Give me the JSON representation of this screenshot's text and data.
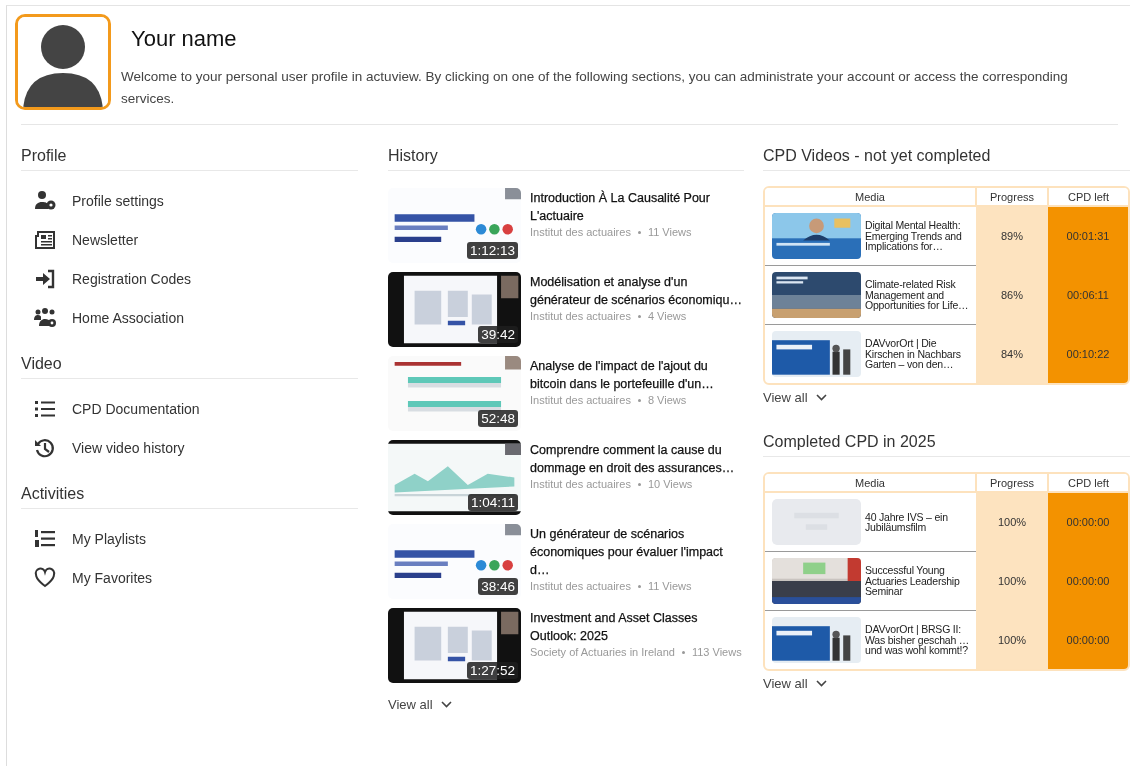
{
  "header": {
    "name": "Your name",
    "welcome": "Welcome to your personal user profile in actuview. By clicking on one of the following sections, you can administrate your account or access the corresponding services."
  },
  "menu_sections": [
    {
      "title": "Profile",
      "items": [
        {
          "label": "Profile settings"
        },
        {
          "label": "Newsletter"
        },
        {
          "label": "Registration Codes"
        },
        {
          "label": "Home Association"
        }
      ]
    },
    {
      "title": "Video",
      "items": [
        {
          "label": "CPD Documentation"
        },
        {
          "label": "View video history"
        }
      ]
    },
    {
      "title": "Activities",
      "items": [
        {
          "label": "My Playlists"
        },
        {
          "label": "My Favorites"
        }
      ]
    }
  ],
  "history": {
    "title": "History",
    "videos": [
      {
        "title": "Introduction À La Causalité Pour L'actuaire",
        "channel": "Institut des actuaires",
        "views": "11 Views",
        "duration": "1:12:13"
      },
      {
        "title": "Modélisation et analyse d'un générateur de scénarios économiqu…",
        "channel": "Institut des actuaires",
        "views": "4 Views",
        "duration": "39:42"
      },
      {
        "title": "Analyse de l'impact de l'ajout du bitcoin dans le portefeuille d'un…",
        "channel": "Institut des actuaires",
        "views": "8 Views",
        "duration": "52:48"
      },
      {
        "title": "Comprendre comment la cause du dommage en droit des assurances…",
        "channel": "Institut des actuaires",
        "views": "10 Views",
        "duration": "1:04:11"
      },
      {
        "title": "Un générateur de scénarios économiques pour évaluer l'impact d…",
        "channel": "Institut des actuaires",
        "views": "11 Views",
        "duration": "38:46"
      },
      {
        "title": "Investment and Asset Classes Outlook: 2025",
        "channel": "Society of Actuaries in Ireland",
        "views": "113 Views",
        "duration": "1:27:52"
      }
    ],
    "view_all": "View all"
  },
  "cpd_tables": [
    {
      "title": "CPD Videos - not yet completed",
      "columns": [
        "Media",
        "Progress",
        "CPD left"
      ],
      "rows": [
        {
          "media": "Digital Mental Health: Emerging Trends and Implications for…",
          "progress": "89%",
          "cpd_left": "00:01:31"
        },
        {
          "media": "Climate-related Risk Management and Opportunities for Life…",
          "progress": "86%",
          "cpd_left": "00:06:11"
        },
        {
          "media": "DAVvorOrt | Die Kirschen in Nachbars Garten – von den…",
          "progress": "84%",
          "cpd_left": "00:10:22"
        }
      ],
      "view_all": "View all"
    },
    {
      "title": "Completed CPD in 2025",
      "columns": [
        "Media",
        "Progress",
        "CPD left"
      ],
      "rows": [
        {
          "media": "40 Jahre IVS – ein Jubiläumsfilm",
          "progress": "100%",
          "cpd_left": "00:00:00"
        },
        {
          "media": "Successful Young Actuaries Leadership Seminar",
          "progress": "100%",
          "cpd_left": "00:00:00"
        },
        {
          "media": "DAVvorOrt | BRSG II: Was bisher geschah … und was wohl kommt!?",
          "progress": "100%",
          "cpd_left": "00:00:00"
        }
      ],
      "view_all": "View all"
    }
  ]
}
